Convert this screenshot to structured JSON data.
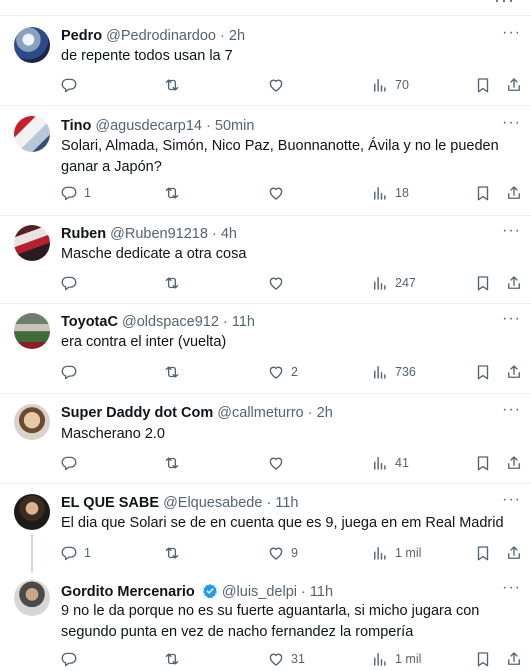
{
  "tweets": [
    {
      "name": "Pedro",
      "handle": "@Pedrodinardoo",
      "time": "2h",
      "text": "de repente todos usan la 7",
      "replies": "",
      "retweets": "",
      "likes": "",
      "views": "70"
    },
    {
      "name": "Tino",
      "handle": "@agusdecarp14",
      "time": "50min",
      "text": "Solari, Almada, Simón, Nico Paz, Buonnanotte, Ávila y no le pueden ganar a Japón?",
      "replies": "1",
      "retweets": "",
      "likes": "",
      "views": "18"
    },
    {
      "name": "Ruben",
      "handle": "@Ruben91218",
      "time": "4h",
      "text": "Masche dedicate a otra cosa",
      "replies": "",
      "retweets": "",
      "likes": "",
      "views": "247"
    },
    {
      "name": "ToyotaC",
      "handle": "@oldspace912",
      "time": "11h",
      "text": "era contra el inter (vuelta)",
      "replies": "",
      "retweets": "",
      "likes": "2",
      "views": "736"
    },
    {
      "name": "Super Daddy dot Com",
      "handle": "@callmeturro",
      "time": "2h",
      "text": "Mascherano 2.0",
      "replies": "",
      "retweets": "",
      "likes": "",
      "views": "41"
    },
    {
      "name": "EL QUE SABE",
      "handle": "@Elquesabede",
      "time": "11h",
      "text": "El dia que Solari se de en cuenta que es 9, juega en em Real Madrid",
      "replies": "1",
      "retweets": "",
      "likes": "9",
      "views": "1 mil"
    },
    {
      "name": "Gordito Mercenario",
      "handle": "@luis_delpi",
      "time": "11h",
      "text": "9 no le da porque no es su fuerte aguantarla, si micho jugara con segundo punta en vez de nacho fernandez la rompería",
      "replies": "",
      "retweets": "",
      "likes": "31",
      "views": "1 mil"
    }
  ],
  "separator": "·",
  "more_glyph": "···",
  "colors": {
    "text_primary": "#0f1419",
    "text_secondary": "#536471",
    "divider": "#eff3f4",
    "verified": "#1d9bf0"
  }
}
